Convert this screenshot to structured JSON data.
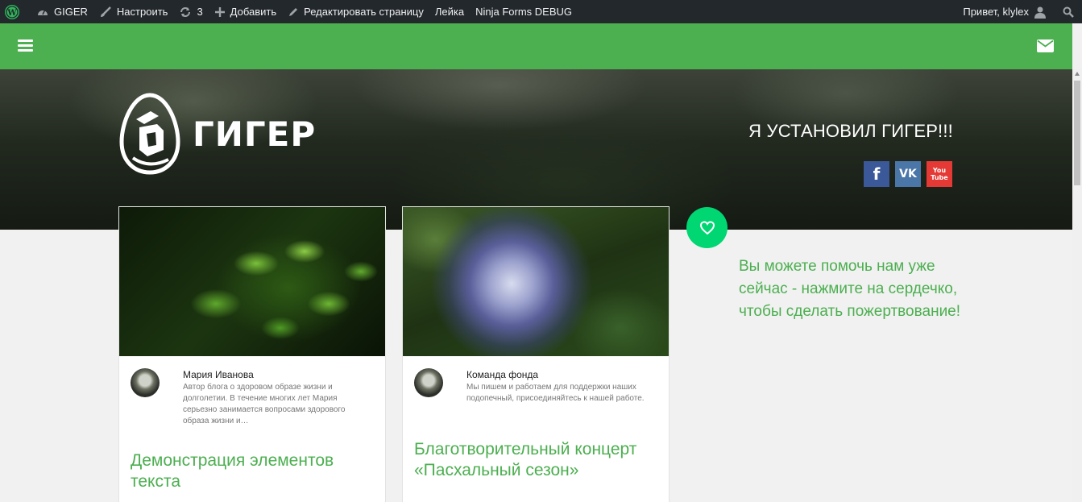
{
  "adminbar": {
    "site_name": "GIGER",
    "customize": "Настроить",
    "updates_count": "3",
    "add_new": "Добавить",
    "edit_page": "Редактировать страницу",
    "leika": "Лейка",
    "ninja_forms": "Ninja Forms DEBUG",
    "greeting": "Привет, klylex"
  },
  "header": {
    "logo_text": "ГИГЕР",
    "tagline": "Я УСТАНОВИЛ ГИГЕР!!!",
    "social": [
      {
        "icon": "facebook-icon",
        "label": "f",
        "color": "#3b5998"
      },
      {
        "icon": "vk-icon",
        "label": "VK",
        "color": "#4a76a8"
      },
      {
        "icon": "youtube-icon",
        "label": "You Tube",
        "color": "#e53935"
      }
    ],
    "green": "#4caf50"
  },
  "posts": [
    {
      "image": "leaves-photo",
      "author_name": "Мария Иванова",
      "author_bio": "Автор блога о здоровом образе жизни и долголетии. В течение многих лет Мария серьезно занимается вопросами здорового образа жизни и…",
      "title": "Демонстрация элементов текста"
    },
    {
      "image": "flower-photo",
      "author_name": "Команда фонда",
      "author_bio": "Мы пишем и работаем для поддержки наших подопечный, присоединяйтесь к нашей работе.",
      "title": "Благотворительный концерт «Пасхальный сезон»"
    }
  ],
  "donate": {
    "icon": "heart-icon",
    "text": "Вы можете помочь нам уже сейчас - нажмите на сердечко, чтобы сделать пожертвование!",
    "button_color": "#00d672"
  }
}
